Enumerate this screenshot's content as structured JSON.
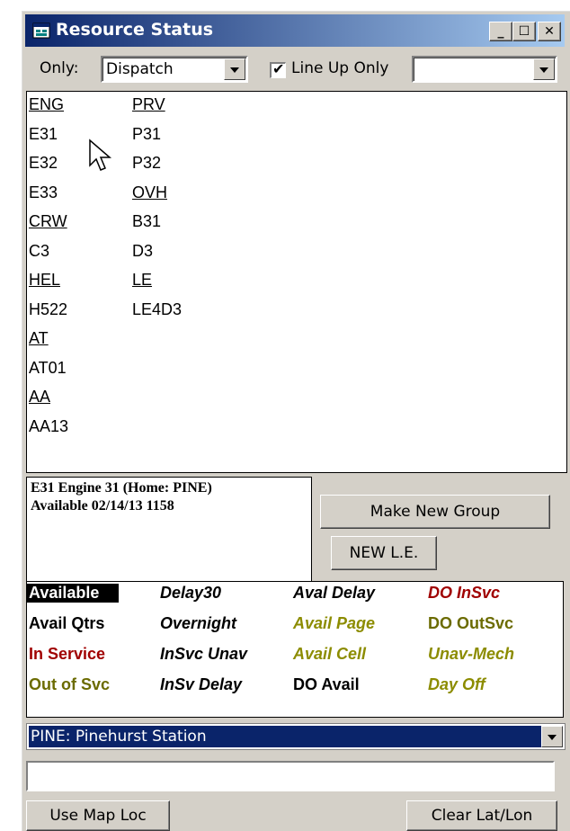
{
  "window": {
    "title": "Resource Status"
  },
  "filter": {
    "only_label": "Only:",
    "only_value": "Dispatch",
    "lineup_checked": true,
    "lineup_label": "Line Up Only",
    "second_value": ""
  },
  "resources": {
    "col1": [
      {
        "text": "ENG",
        "header": true
      },
      {
        "text": "E31",
        "header": false
      },
      {
        "text": "E32",
        "header": false
      },
      {
        "text": "E33",
        "header": false
      },
      {
        "text": "CRW",
        "header": true
      },
      {
        "text": "C3",
        "header": false
      },
      {
        "text": "HEL",
        "header": true
      },
      {
        "text": "H522",
        "header": false
      },
      {
        "text": "AT",
        "header": true
      },
      {
        "text": "AT01",
        "header": false
      },
      {
        "text": "AA",
        "header": true
      },
      {
        "text": "AA13",
        "header": false
      }
    ],
    "col2": [
      {
        "text": "PRV",
        "header": true
      },
      {
        "text": "P31",
        "header": false
      },
      {
        "text": "P32",
        "header": false
      },
      {
        "text": "OVH",
        "header": true
      },
      {
        "text": "B31",
        "header": false
      },
      {
        "text": "D3",
        "header": false
      },
      {
        "text": "LE",
        "header": true
      },
      {
        "text": "LE4D3",
        "header": false
      }
    ]
  },
  "info": {
    "line1": "E31 Engine 31 (Home: PINE)",
    "line2": "Available 02/14/13 1158"
  },
  "buttons": {
    "make_group": "Make New Group",
    "new_le": "NEW L.E.",
    "use_map": "Use Map Loc",
    "clear_latlon": "Clear Lat/Lon"
  },
  "legend": [
    {
      "text": "Available",
      "color": "#ffffff",
      "bg": "#000000",
      "italic": false
    },
    {
      "text": "Delay30",
      "color": "#000000",
      "italic": true
    },
    {
      "text": "Aval Delay",
      "color": "#000000",
      "italic": true
    },
    {
      "text": "DO InSvc",
      "color": "#a00000",
      "italic": true
    },
    {
      "text": "Avail Qtrs",
      "color": "#000000",
      "italic": false
    },
    {
      "text": "Overnight",
      "color": "#000000",
      "italic": true
    },
    {
      "text": "Avail Page",
      "color": "#8c8c00",
      "italic": true
    },
    {
      "text": "DO OutSvc",
      "color": "#6b6b00",
      "italic": false
    },
    {
      "text": "In Service",
      "color": "#a00000",
      "italic": false
    },
    {
      "text": "InSvc Unav",
      "color": "#000000",
      "italic": true
    },
    {
      "text": "Avail Cell",
      "color": "#8c8c00",
      "italic": true
    },
    {
      "text": "Unav-Mech",
      "color": "#8c8c00",
      "italic": true
    },
    {
      "text": "Out of Svc",
      "color": "#6b6b00",
      "italic": false
    },
    {
      "text": "InSv Delay",
      "color": "#000000",
      "italic": true
    },
    {
      "text": "DO Avail",
      "color": "#000000",
      "italic": false
    },
    {
      "text": "Day Off",
      "color": "#8c8c00",
      "italic": true
    }
  ],
  "station": {
    "value": "PINE: Pinehurst Station"
  },
  "coord_field": {
    "value": ""
  }
}
